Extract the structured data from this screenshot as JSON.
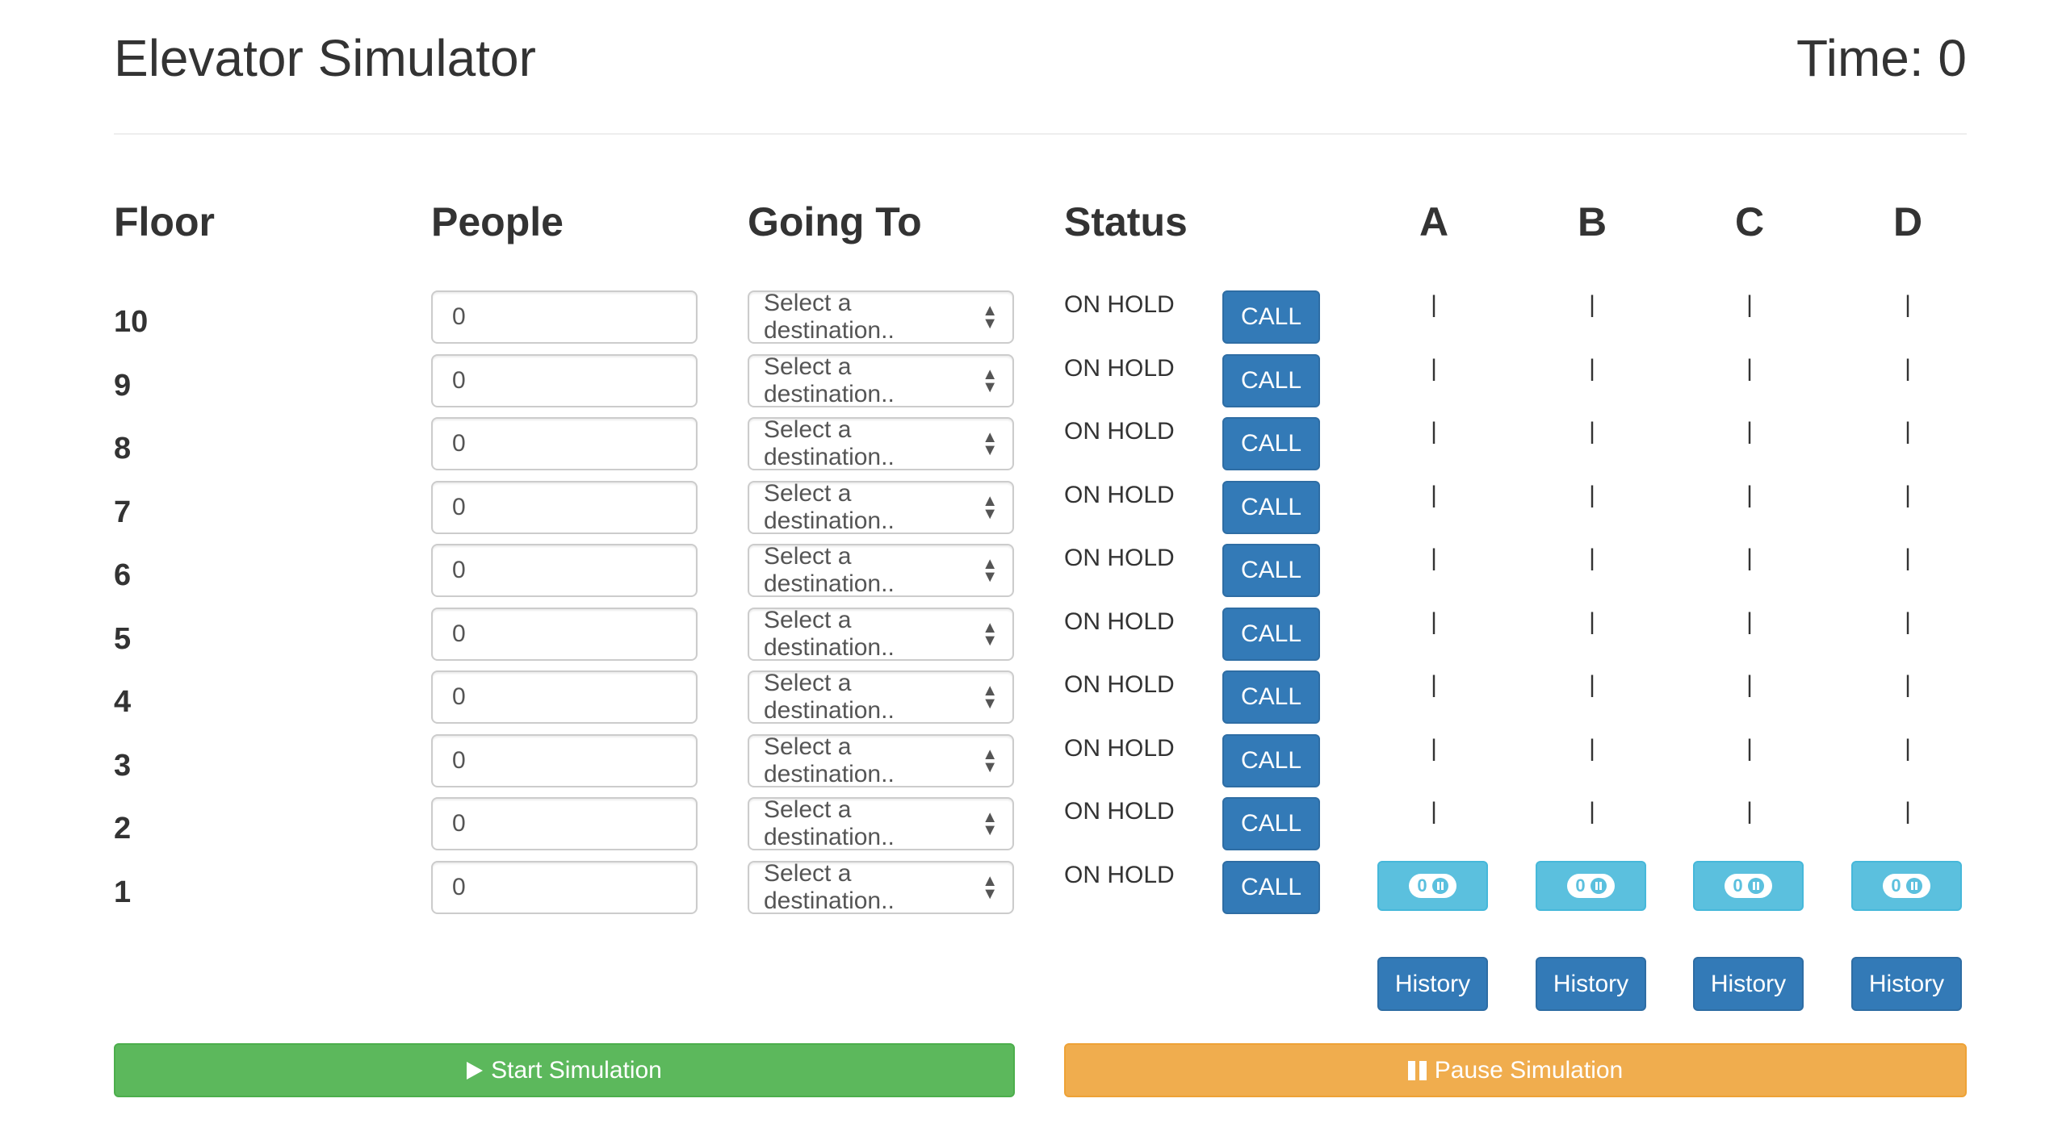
{
  "header": {
    "title": "Elevator Simulator",
    "time_label": "Time: 0"
  },
  "columns": {
    "floor": "Floor",
    "people": "People",
    "going_to": "Going To",
    "status": "Status"
  },
  "elevators": [
    {
      "name": "A",
      "count": "0",
      "history_label": "History"
    },
    {
      "name": "B",
      "count": "0",
      "history_label": "History"
    },
    {
      "name": "C",
      "count": "0",
      "history_label": "History"
    },
    {
      "name": "D",
      "count": "0",
      "history_label": "History"
    }
  ],
  "shaft_marker": "|",
  "floors": [
    {
      "number": "10",
      "people": "0",
      "destination": "Select a destination..",
      "status": "ON HOLD",
      "call_label": "CALL"
    },
    {
      "number": "9",
      "people": "0",
      "destination": "Select a destination..",
      "status": "ON HOLD",
      "call_label": "CALL"
    },
    {
      "number": "8",
      "people": "0",
      "destination": "Select a destination..",
      "status": "ON HOLD",
      "call_label": "CALL"
    },
    {
      "number": "7",
      "people": "0",
      "destination": "Select a destination..",
      "status": "ON HOLD",
      "call_label": "CALL"
    },
    {
      "number": "6",
      "people": "0",
      "destination": "Select a destination..",
      "status": "ON HOLD",
      "call_label": "CALL"
    },
    {
      "number": "5",
      "people": "0",
      "destination": "Select a destination..",
      "status": "ON HOLD",
      "call_label": "CALL"
    },
    {
      "number": "4",
      "people": "0",
      "destination": "Select a destination..",
      "status": "ON HOLD",
      "call_label": "CALL"
    },
    {
      "number": "3",
      "people": "0",
      "destination": "Select a destination..",
      "status": "ON HOLD",
      "call_label": "CALL"
    },
    {
      "number": "2",
      "people": "0",
      "destination": "Select a destination..",
      "status": "ON HOLD",
      "call_label": "CALL"
    },
    {
      "number": "1",
      "people": "0",
      "destination": "Select a destination..",
      "status": "ON HOLD",
      "call_label": "CALL"
    }
  ],
  "elevator_positions_floor": [
    "1",
    "1",
    "1",
    "1"
  ],
  "controls": {
    "start_label": "Start Simulation",
    "pause_label": "Pause Simulation"
  },
  "colors": {
    "primary": "#337ab7",
    "info": "#5bc0de",
    "success": "#5cb85c",
    "warning": "#f0ad4e"
  },
  "icons": {
    "start": "play-icon",
    "pause": "pause-icon",
    "select": "updown-arrows-icon"
  }
}
